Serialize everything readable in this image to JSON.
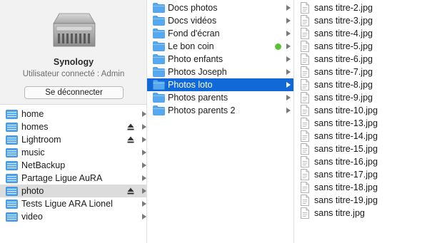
{
  "colors": {
    "selection_blue": "#1169d8",
    "selection_grey": "#dcdcdc",
    "folder_blue": "#56a9f0",
    "tag_green": "#5bc236"
  },
  "server": {
    "icon": "server-rack-icon",
    "name": "Synology",
    "user_status": "Utilisateur connecté : Admin",
    "logout_label": "Se déconnecter"
  },
  "shares": [
    {
      "label": "home"
    },
    {
      "label": "homes",
      "eject": true
    },
    {
      "label": "Lightroom",
      "eject": true
    },
    {
      "label": "music"
    },
    {
      "label": "NetBackup"
    },
    {
      "label": "Partage Ligue AuRA"
    },
    {
      "label": "photo",
      "eject": true,
      "selected": true
    },
    {
      "label": "Tests Ligue ARA Lionel"
    },
    {
      "label": "video"
    }
  ],
  "folders": [
    {
      "label": "Docs photos"
    },
    {
      "label": "Docs vidéos"
    },
    {
      "label": "Fond d'écran"
    },
    {
      "label": "Le bon coin",
      "tag": "green"
    },
    {
      "label": "Photo enfants"
    },
    {
      "label": "Photos Joseph"
    },
    {
      "label": "Photos loto",
      "selected": true
    },
    {
      "label": "Photos parents"
    },
    {
      "label": "Photos parents 2"
    }
  ],
  "files": [
    {
      "label": "sans titre-2.jpg"
    },
    {
      "label": "sans titre-3.jpg"
    },
    {
      "label": "sans titre-4.jpg"
    },
    {
      "label": "sans titre-5.jpg"
    },
    {
      "label": "sans titre-6.jpg"
    },
    {
      "label": "sans titre-7.jpg"
    },
    {
      "label": "sans titre-8.jpg"
    },
    {
      "label": "sans titre-9.jpg"
    },
    {
      "label": "sans titre-10.jpg"
    },
    {
      "label": "sans titre-13.jpg"
    },
    {
      "label": "sans titre-14.jpg"
    },
    {
      "label": "sans titre-15.jpg"
    },
    {
      "label": "sans titre-16.jpg"
    },
    {
      "label": "sans titre-17.jpg"
    },
    {
      "label": "sans titre-18.jpg"
    },
    {
      "label": "sans titre-19.jpg"
    },
    {
      "label": "sans titre.jpg"
    }
  ]
}
